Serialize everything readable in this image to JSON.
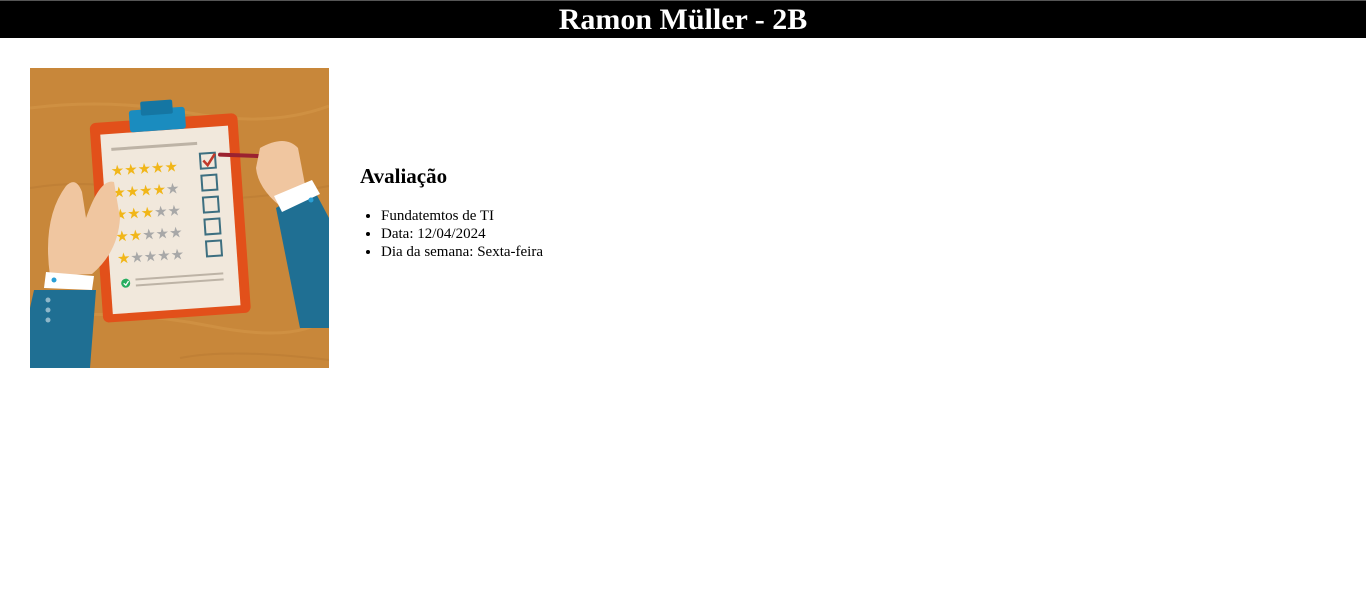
{
  "header": {
    "title": "Ramon Müller - 2B"
  },
  "illustration": {
    "icon": "clipboard-rating-icon",
    "colors": {
      "background": "#c8873a",
      "clipboard": "#e2501a",
      "paper": "#f1e8dc",
      "star_filled": "#f1b619",
      "star_empty": "#a8a8a8",
      "sleeve": "#1f6f93",
      "skin": "#f0c6a0",
      "pen": "#9b2230"
    }
  },
  "evaluation": {
    "heading": "Avaliação",
    "items": [
      "Fundatemtos de TI",
      "Data: 12/04/2024",
      "Dia da semana: Sexta-feira"
    ]
  }
}
